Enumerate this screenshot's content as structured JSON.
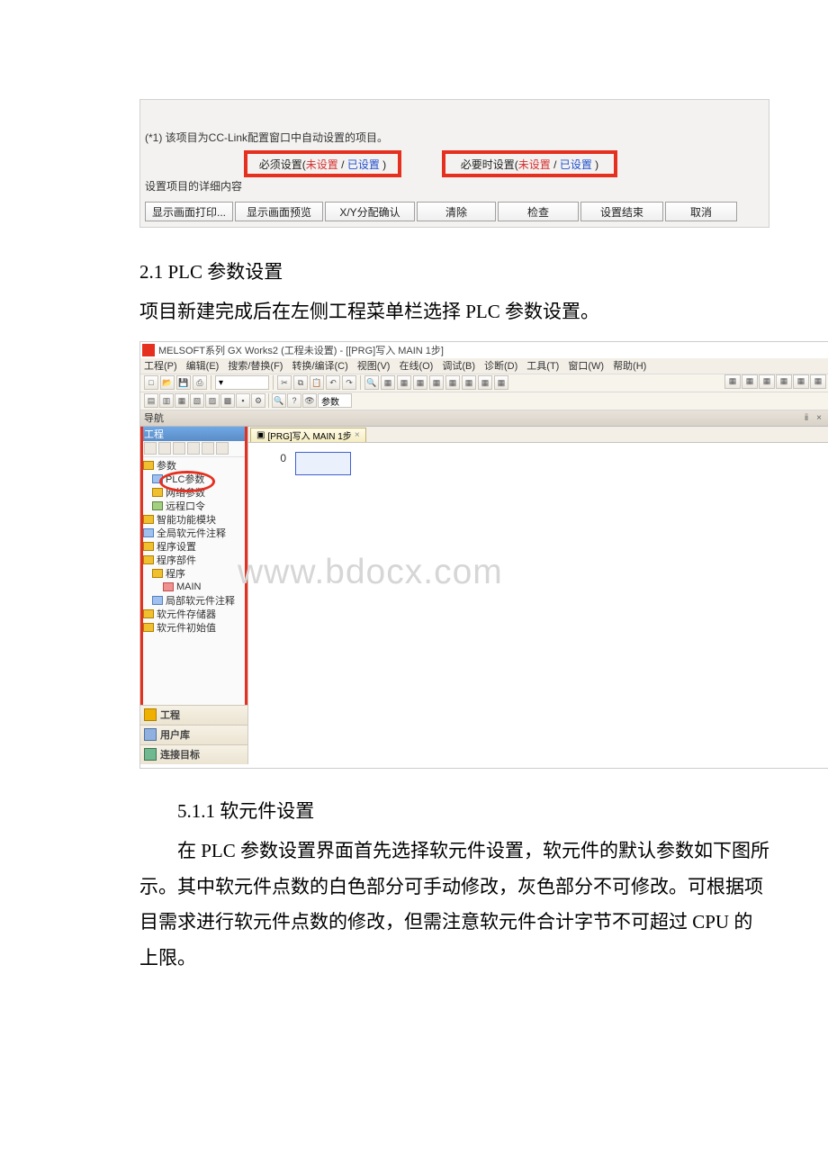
{
  "dialog1": {
    "note": "(*1) 该项目为CC-Link配置窗口中自动设置的项目。",
    "legend1_a": "必须设置(",
    "legend1_b": "未设置",
    "legend1_c": " / ",
    "legend1_d": "已设置",
    "legend1_e": " )",
    "legend2_a": "必要时设置(",
    "detail": "设置项目的详细内容",
    "buttons": {
      "b1": "显示画面打印...",
      "b2": "显示画面预览",
      "b3": "X/Y分配确认",
      "b4": "清除",
      "b5": "检查",
      "b6": "设置结束",
      "b7": "取消"
    }
  },
  "section21_title": "2.1 PLC 参数设置",
  "section21_body": "项目新建完成后在左侧工程菜单栏选择 PLC 参数设置。",
  "gxworks": {
    "title": "MELSOFT系列 GX Works2 (工程未设置) - [[PRG]写入 MAIN 1步]",
    "menus": {
      "m1": "工程(P)",
      "m2": "编辑(E)",
      "m3": "搜索/替换(F)",
      "m4": "转换/编译(C)",
      "m5": "视图(V)",
      "m6": "在线(O)",
      "m7": "调试(B)",
      "m8": "诊断(D)",
      "m9": "工具(T)",
      "m10": "窗口(W)",
      "m11": "帮助(H)"
    },
    "nav_title": "导航",
    "nav_pins": "ⅱ ×",
    "proj_label": "工程",
    "tree": {
      "t1": "参数",
      "t2": "PLC参数",
      "t3": "网络参数",
      "t4": "远程口令",
      "t5": "智能功能模块",
      "t6": "全局软元件注释",
      "t7": "程序设置",
      "t8": "程序部件",
      "t9": "程序",
      "t10": "MAIN",
      "t11": "局部软元件注释",
      "t12": "软元件存储器",
      "t13": "软元件初始值"
    },
    "navbtns": {
      "b1": "工程",
      "b2": "用户库",
      "b3": "连接目标"
    },
    "tab_label": "[PRG]写入 MAIN 1步",
    "rung_num": "0"
  },
  "watermark": "www.bdocx.com",
  "section511_title": "5.1.1 软元件设置",
  "section511_body": "在 PLC 参数设置界面首先选择软元件设置，软元件的默认参数如下图所示。其中软元件点数的白色部分可手动修改，灰色部分不可修改。可根据项目需求进行软元件点数的修改，但需注意软元件合计字节不可超过 CPU 的上限。"
}
